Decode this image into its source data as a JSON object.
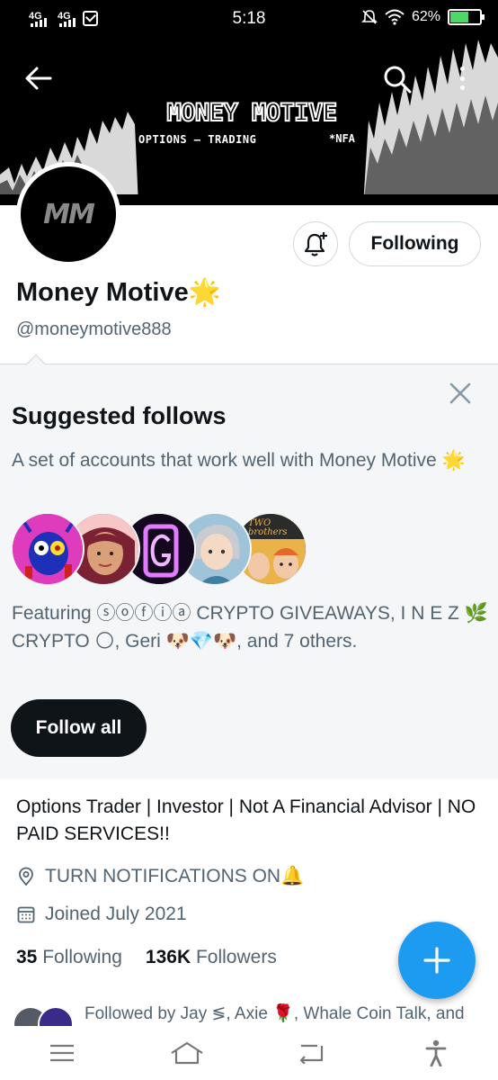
{
  "status_bar": {
    "network_1": "4G",
    "network_2": "4G",
    "time": "5:18",
    "battery": "62%",
    "battery_level": 0.62
  },
  "banner": {
    "title": "MONEY MOTIVE",
    "subtitle": "OPTIONS — TRADING",
    "tag": "*NFA",
    "logo_text": "MM"
  },
  "profile": {
    "following_button": "Following",
    "name": "Money Motive🌟",
    "handle": "@moneymotive888",
    "bio": "Options Trader | Investor | Not A Financial Advisor | NO PAID SERVICES!!",
    "location": "TURN NOTIFICATIONS ON🔔",
    "joined": "Joined July 2021",
    "following_count": "35",
    "following_label": "Following",
    "followers_count": "136K",
    "followers_label": "Followers",
    "followed_by": "Followed by Jay ≶, Axie 🌹, Whale Coin Talk, and"
  },
  "suggested": {
    "title": "Suggested follows",
    "description": "A set of accounts that work well with Money Motive 🌟",
    "featuring": "Featuring ⓢⓞⓕⓘⓐ CRYPTO GIVEAWAYS, I N E Z 🌿 CRYPTO 🌕, Geri 🐶💎🐶, and 7 others.",
    "avatar_5_text": "TWO brothers",
    "follow_all": "Follow all"
  },
  "icons": {
    "back": "arrow-left-icon",
    "search": "search-icon",
    "more": "more-vertical-icon",
    "bell": "bell-plus-icon",
    "close": "close-icon",
    "location": "location-pin-icon",
    "calendar": "calendar-icon",
    "compose": "plus-icon",
    "menu": "menu-icon",
    "home": "home-icon",
    "back_nav": "return-icon",
    "accessibility": "accessibility-icon"
  },
  "colors": {
    "accent": "#1d9bf0",
    "text_primary": "#0f1419",
    "text_secondary": "#536471",
    "panel_bg": "#f4f6f8"
  }
}
